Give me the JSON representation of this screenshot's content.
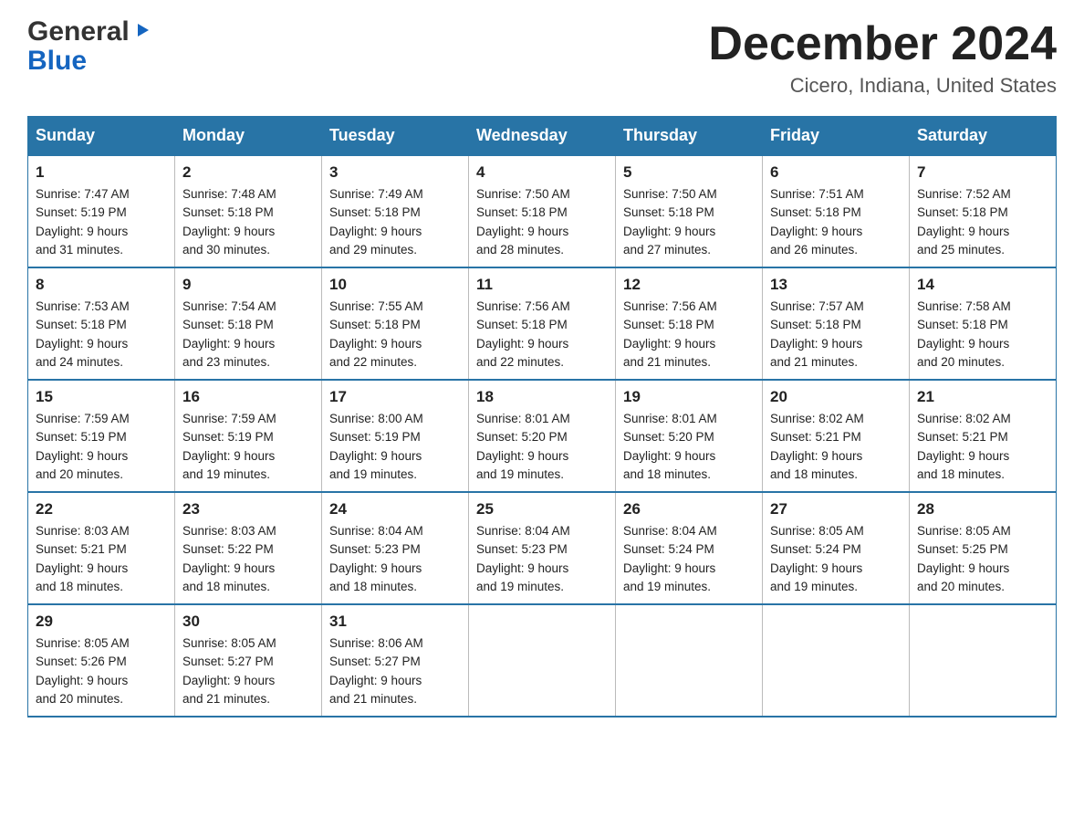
{
  "header": {
    "logo_general": "General",
    "logo_blue": "Blue",
    "month_title": "December 2024",
    "location": "Cicero, Indiana, United States"
  },
  "days_of_week": [
    "Sunday",
    "Monday",
    "Tuesday",
    "Wednesday",
    "Thursday",
    "Friday",
    "Saturday"
  ],
  "weeks": [
    [
      {
        "day": "1",
        "sunrise": "7:47 AM",
        "sunset": "5:19 PM",
        "daylight": "9 hours and 31 minutes."
      },
      {
        "day": "2",
        "sunrise": "7:48 AM",
        "sunset": "5:18 PM",
        "daylight": "9 hours and 30 minutes."
      },
      {
        "day": "3",
        "sunrise": "7:49 AM",
        "sunset": "5:18 PM",
        "daylight": "9 hours and 29 minutes."
      },
      {
        "day": "4",
        "sunrise": "7:50 AM",
        "sunset": "5:18 PM",
        "daylight": "9 hours and 28 minutes."
      },
      {
        "day": "5",
        "sunrise": "7:50 AM",
        "sunset": "5:18 PM",
        "daylight": "9 hours and 27 minutes."
      },
      {
        "day": "6",
        "sunrise": "7:51 AM",
        "sunset": "5:18 PM",
        "daylight": "9 hours and 26 minutes."
      },
      {
        "day": "7",
        "sunrise": "7:52 AM",
        "sunset": "5:18 PM",
        "daylight": "9 hours and 25 minutes."
      }
    ],
    [
      {
        "day": "8",
        "sunrise": "7:53 AM",
        "sunset": "5:18 PM",
        "daylight": "9 hours and 24 minutes."
      },
      {
        "day": "9",
        "sunrise": "7:54 AM",
        "sunset": "5:18 PM",
        "daylight": "9 hours and 23 minutes."
      },
      {
        "day": "10",
        "sunrise": "7:55 AM",
        "sunset": "5:18 PM",
        "daylight": "9 hours and 22 minutes."
      },
      {
        "day": "11",
        "sunrise": "7:56 AM",
        "sunset": "5:18 PM",
        "daylight": "9 hours and 22 minutes."
      },
      {
        "day": "12",
        "sunrise": "7:56 AM",
        "sunset": "5:18 PM",
        "daylight": "9 hours and 21 minutes."
      },
      {
        "day": "13",
        "sunrise": "7:57 AM",
        "sunset": "5:18 PM",
        "daylight": "9 hours and 21 minutes."
      },
      {
        "day": "14",
        "sunrise": "7:58 AM",
        "sunset": "5:18 PM",
        "daylight": "9 hours and 20 minutes."
      }
    ],
    [
      {
        "day": "15",
        "sunrise": "7:59 AM",
        "sunset": "5:19 PM",
        "daylight": "9 hours and 20 minutes."
      },
      {
        "day": "16",
        "sunrise": "7:59 AM",
        "sunset": "5:19 PM",
        "daylight": "9 hours and 19 minutes."
      },
      {
        "day": "17",
        "sunrise": "8:00 AM",
        "sunset": "5:19 PM",
        "daylight": "9 hours and 19 minutes."
      },
      {
        "day": "18",
        "sunrise": "8:01 AM",
        "sunset": "5:20 PM",
        "daylight": "9 hours and 19 minutes."
      },
      {
        "day": "19",
        "sunrise": "8:01 AM",
        "sunset": "5:20 PM",
        "daylight": "9 hours and 18 minutes."
      },
      {
        "day": "20",
        "sunrise": "8:02 AM",
        "sunset": "5:21 PM",
        "daylight": "9 hours and 18 minutes."
      },
      {
        "day": "21",
        "sunrise": "8:02 AM",
        "sunset": "5:21 PM",
        "daylight": "9 hours and 18 minutes."
      }
    ],
    [
      {
        "day": "22",
        "sunrise": "8:03 AM",
        "sunset": "5:21 PM",
        "daylight": "9 hours and 18 minutes."
      },
      {
        "day": "23",
        "sunrise": "8:03 AM",
        "sunset": "5:22 PM",
        "daylight": "9 hours and 18 minutes."
      },
      {
        "day": "24",
        "sunrise": "8:04 AM",
        "sunset": "5:23 PM",
        "daylight": "9 hours and 18 minutes."
      },
      {
        "day": "25",
        "sunrise": "8:04 AM",
        "sunset": "5:23 PM",
        "daylight": "9 hours and 19 minutes."
      },
      {
        "day": "26",
        "sunrise": "8:04 AM",
        "sunset": "5:24 PM",
        "daylight": "9 hours and 19 minutes."
      },
      {
        "day": "27",
        "sunrise": "8:05 AM",
        "sunset": "5:24 PM",
        "daylight": "9 hours and 19 minutes."
      },
      {
        "day": "28",
        "sunrise": "8:05 AM",
        "sunset": "5:25 PM",
        "daylight": "9 hours and 20 minutes."
      }
    ],
    [
      {
        "day": "29",
        "sunrise": "8:05 AM",
        "sunset": "5:26 PM",
        "daylight": "9 hours and 20 minutes."
      },
      {
        "day": "30",
        "sunrise": "8:05 AM",
        "sunset": "5:27 PM",
        "daylight": "9 hours and 21 minutes."
      },
      {
        "day": "31",
        "sunrise": "8:06 AM",
        "sunset": "5:27 PM",
        "daylight": "9 hours and 21 minutes."
      },
      null,
      null,
      null,
      null
    ]
  ]
}
